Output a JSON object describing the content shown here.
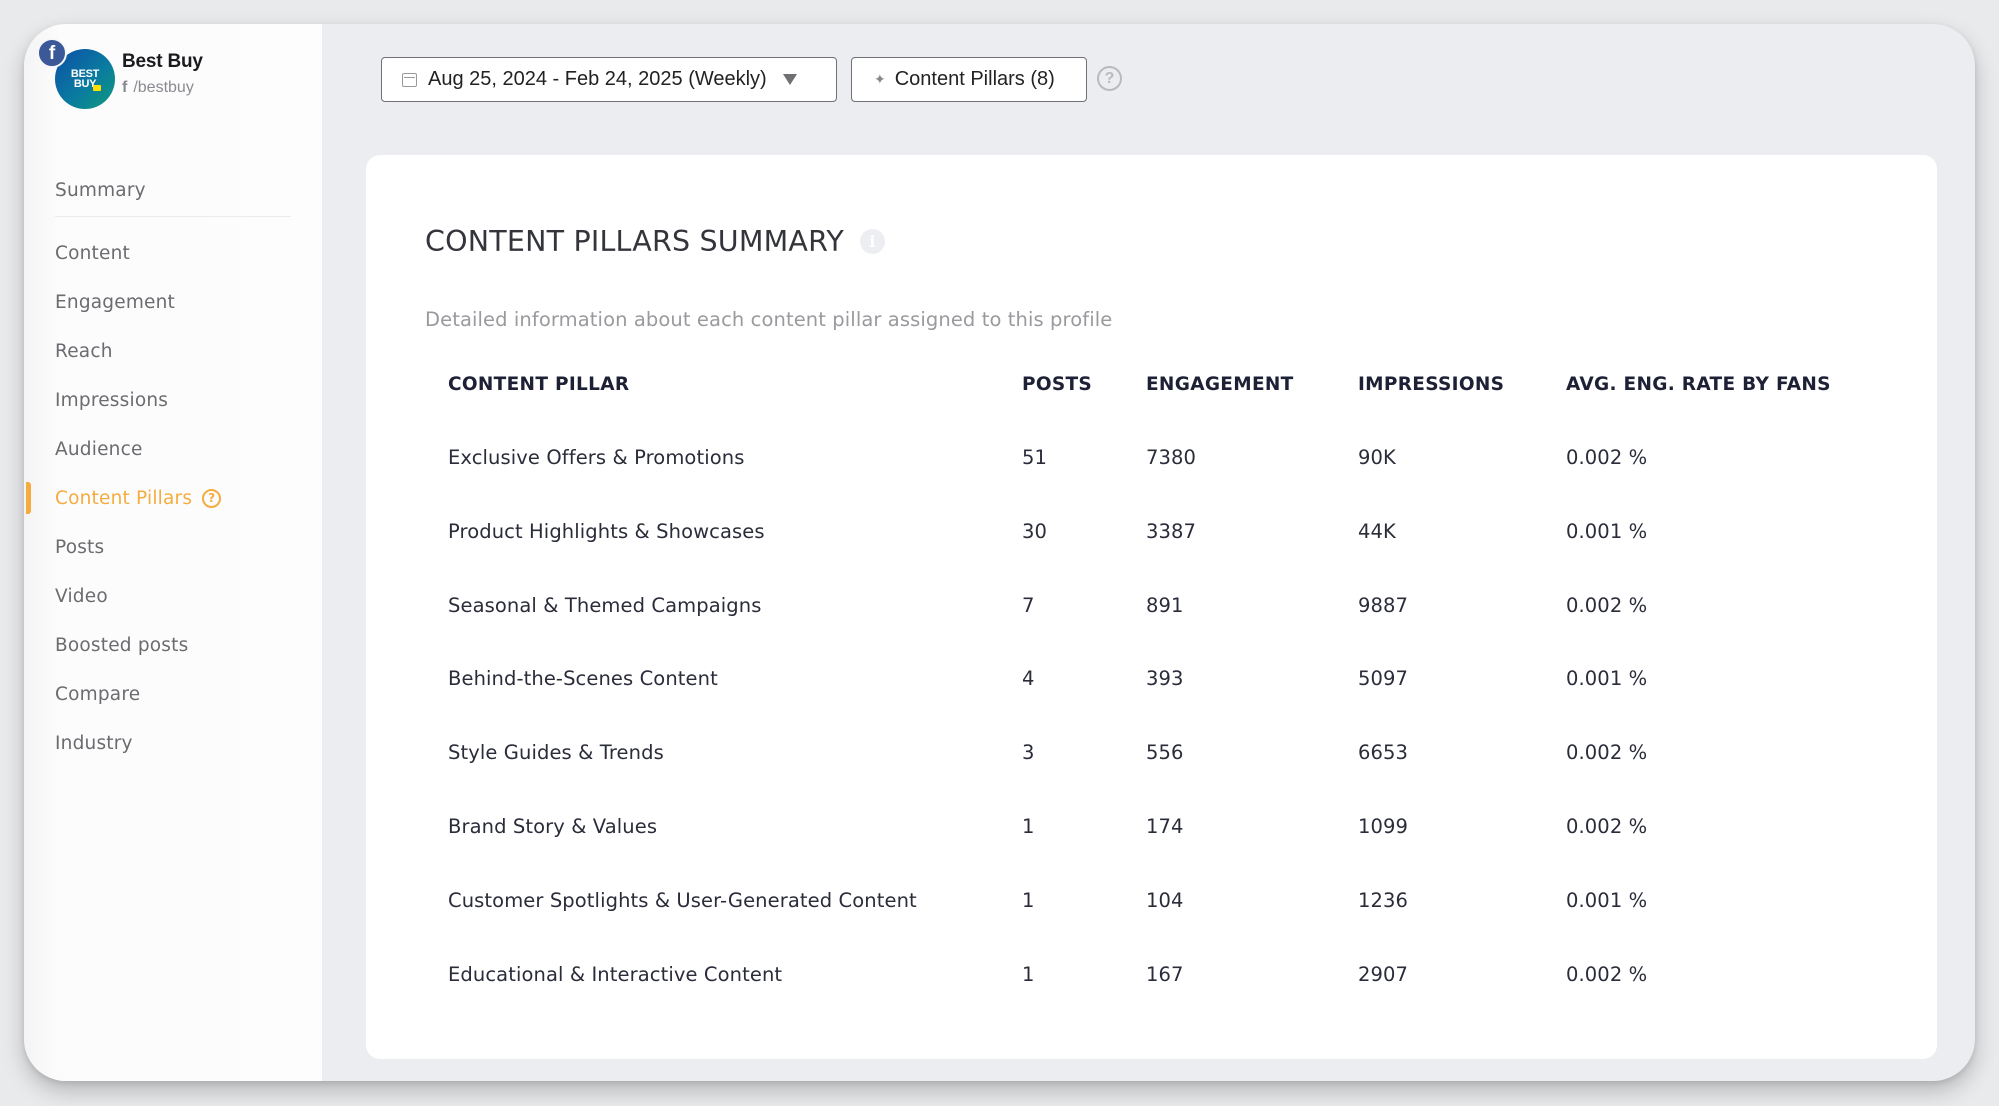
{
  "profile": {
    "name": "Best Buy",
    "handle": "/bestbuy",
    "avatar_text_line1": "BEST",
    "avatar_text_line2": "BUY",
    "network_icon": "facebook-icon",
    "network_glyph": "f"
  },
  "sidebar": {
    "items": [
      {
        "label": "Summary",
        "active": false
      },
      {
        "label": "Content",
        "active": false
      },
      {
        "label": "Engagement",
        "active": false
      },
      {
        "label": "Reach",
        "active": false
      },
      {
        "label": "Impressions",
        "active": false
      },
      {
        "label": "Audience",
        "active": false
      },
      {
        "label": "Content Pillars",
        "active": true,
        "help_glyph": "?"
      },
      {
        "label": "Posts",
        "active": false
      },
      {
        "label": "Video",
        "active": false
      },
      {
        "label": "Boosted posts",
        "active": false
      },
      {
        "label": "Compare",
        "active": false
      },
      {
        "label": "Industry",
        "active": false
      }
    ]
  },
  "toolbar": {
    "date_range": "Aug 25, 2024 - Feb 24, 2025 (Weekly)",
    "content_pillars_label": "Content Pillars (8)",
    "spark_glyph": "✦",
    "help_glyph": "?"
  },
  "card": {
    "title": "CONTENT PILLARS SUMMARY",
    "info_glyph": "i",
    "subtitle": "Detailed information about each content pillar assigned to this profile"
  },
  "table": {
    "columns": [
      "CONTENT PILLAR",
      "POSTS",
      "ENGAGEMENT",
      "IMPRESSIONS",
      "AVG. ENG. RATE BY FANS"
    ],
    "rows": [
      [
        "Exclusive Offers & Promotions",
        "51",
        "7380",
        "90K",
        "0.002 %"
      ],
      [
        "Product Highlights & Showcases",
        "30",
        "3387",
        "44K",
        "0.001 %"
      ],
      [
        "Seasonal & Themed Campaigns",
        "7",
        "891",
        "9887",
        "0.002 %"
      ],
      [
        "Behind-the-Scenes Content",
        "4",
        "393",
        "5097",
        "0.001 %"
      ],
      [
        "Style Guides & Trends",
        "3",
        "556",
        "6653",
        "0.002 %"
      ],
      [
        "Brand Story & Values",
        "1",
        "174",
        "1099",
        "0.002 %"
      ],
      [
        "Customer Spotlights & User-Generated Content",
        "1",
        "104",
        "1236",
        "0.001 %"
      ],
      [
        "Educational & Interactive Content",
        "1",
        "167",
        "2907",
        "0.002 %"
      ]
    ]
  },
  "colors": {
    "accent": "#f5ac3f",
    "facebook": "#3b5998",
    "background": "#ecedf1"
  }
}
